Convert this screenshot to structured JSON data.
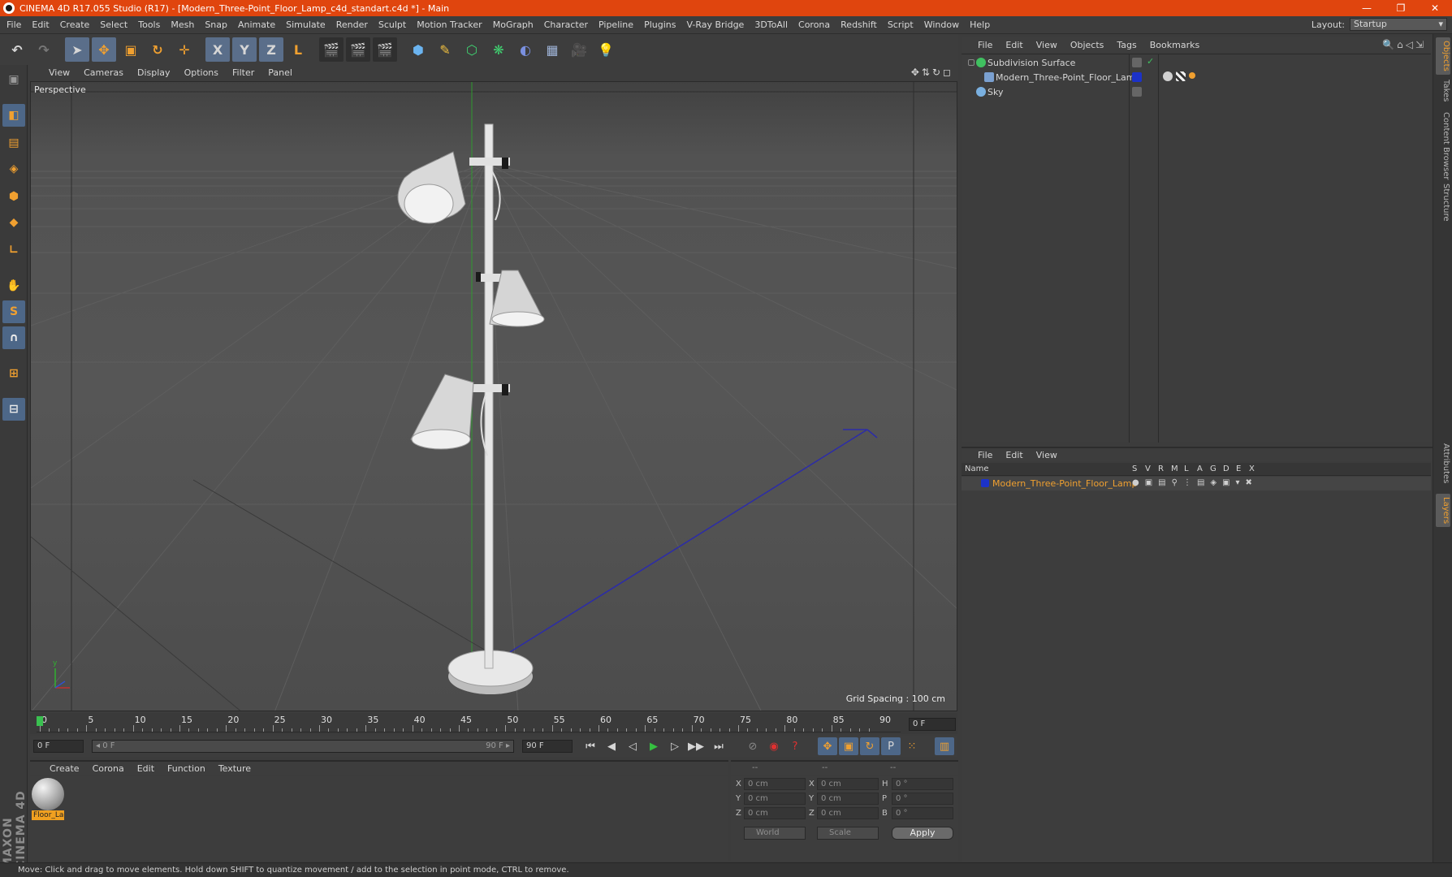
{
  "window": {
    "title": "CINEMA 4D R17.055 Studio (R17) - [Modern_Three-Point_Floor_Lamp_c4d_standart.c4d *] - Main",
    "minimize": "—",
    "restore": "❐",
    "close": "✕"
  },
  "menubar": [
    "File",
    "Edit",
    "Create",
    "Select",
    "Tools",
    "Mesh",
    "Snap",
    "Animate",
    "Simulate",
    "Render",
    "Sculpt",
    "Motion Tracker",
    "MoGraph",
    "Character",
    "Pipeline",
    "Plugins",
    "V-Ray Bridge",
    "3DToAll",
    "Corona",
    "Redshift",
    "Script",
    "Window",
    "Help"
  ],
  "layout": {
    "label": "Layout:",
    "value": "Startup"
  },
  "toolbar": {
    "undo": "↶",
    "redo": "↷",
    "select": "➤",
    "move": "✥",
    "scale": "▣",
    "rotate": "↻",
    "live": "✛",
    "x": "X",
    "y": "Y",
    "z": "Z",
    "coord": "L",
    "render_view": "🎬",
    "render_pv": "🎬",
    "render_settings": "🎬",
    "cube": "⬢",
    "pen": "✎",
    "subdiv": "⬡",
    "array": "❋",
    "deformer": "◐",
    "floor": "▦",
    "camera": "🎥",
    "light": "💡"
  },
  "leftbar": [
    "▣",
    "◧",
    "▤",
    "◈",
    "⬢",
    "◆",
    "∟",
    "✋",
    "S",
    "∩",
    "⊞",
    "⊟"
  ],
  "maxon_logo": "MAXON CINEMA 4D",
  "viewport": {
    "menu": [
      "View",
      "Cameras",
      "Display",
      "Options",
      "Filter",
      "Panel"
    ],
    "icons": "✥⇅↻◻",
    "label": "Perspective",
    "grid_spacing": "Grid Spacing : 100 cm"
  },
  "object_manager": {
    "menu": [
      "File",
      "Edit",
      "View",
      "Objects",
      "Tags",
      "Bookmarks"
    ],
    "icons": "🔍⌂◁⇲",
    "objects": [
      {
        "name": "Subdivision Surface",
        "color": "#d8d8d8"
      },
      {
        "name": "Modern_Three-Point_Floor_Lamp",
        "color": "#d8d8d8"
      },
      {
        "name": "Sky",
        "color": "#d8d8d8"
      }
    ]
  },
  "layer_manager": {
    "menu": [
      "File",
      "Edit",
      "View"
    ],
    "columns": {
      "name": "Name",
      "flags": [
        "S",
        "V",
        "R",
        "M",
        "L",
        "A",
        "G",
        "D",
        "E",
        "X"
      ]
    },
    "layers": [
      {
        "name": "Modern_Three-Point_Floor_Lamp",
        "color": "#f0a030"
      }
    ]
  },
  "right_tabs": [
    "Objects",
    "Takes",
    "Content Browser",
    "Structure",
    "Attributes",
    "Layers"
  ],
  "timeline": {
    "ticks": [
      "0",
      "5",
      "10",
      "15",
      "20",
      "25",
      "30",
      "35",
      "40",
      "45",
      "50",
      "55",
      "60",
      "65",
      "70",
      "75",
      "80",
      "85",
      "90"
    ],
    "current_frame": "0 F"
  },
  "transport": {
    "start": "0 F",
    "range_start": "◂ 0 F",
    "range_end": "90 F ▸",
    "end": "90 F",
    "buttons": [
      "⏮",
      "◀",
      "◁",
      "▶",
      "▷",
      "▶▶",
      "⏭"
    ],
    "play_color": "#35c040"
  },
  "material_manager": {
    "menu": [
      "Create",
      "Corona",
      "Edit",
      "Function",
      "Texture"
    ],
    "materials": [
      {
        "name": "Floor_La"
      }
    ]
  },
  "coordinates": {
    "headers": [
      "--",
      "--",
      "--"
    ],
    "rows": [
      {
        "a": "X",
        "av": "0 cm",
        "b": "X",
        "bv": "0 cm",
        "c": "H",
        "cv": "0 °"
      },
      {
        "a": "Y",
        "av": "0 cm",
        "b": "Y",
        "bv": "0 cm",
        "c": "P",
        "cv": "0 °"
      },
      {
        "a": "Z",
        "av": "0 cm",
        "b": "Z",
        "bv": "0 cm",
        "c": "B",
        "cv": "0 °"
      }
    ],
    "world": "World",
    "scale": "Scale",
    "apply": "Apply"
  },
  "status": "Move: Click and drag to move elements. Hold down SHIFT to quantize movement / add to the selection in point mode, CTRL to remove.",
  "colors": {
    "accent": "#e0450e",
    "selected_tool": "#5a6e8a",
    "highlight": "#f0a030"
  }
}
